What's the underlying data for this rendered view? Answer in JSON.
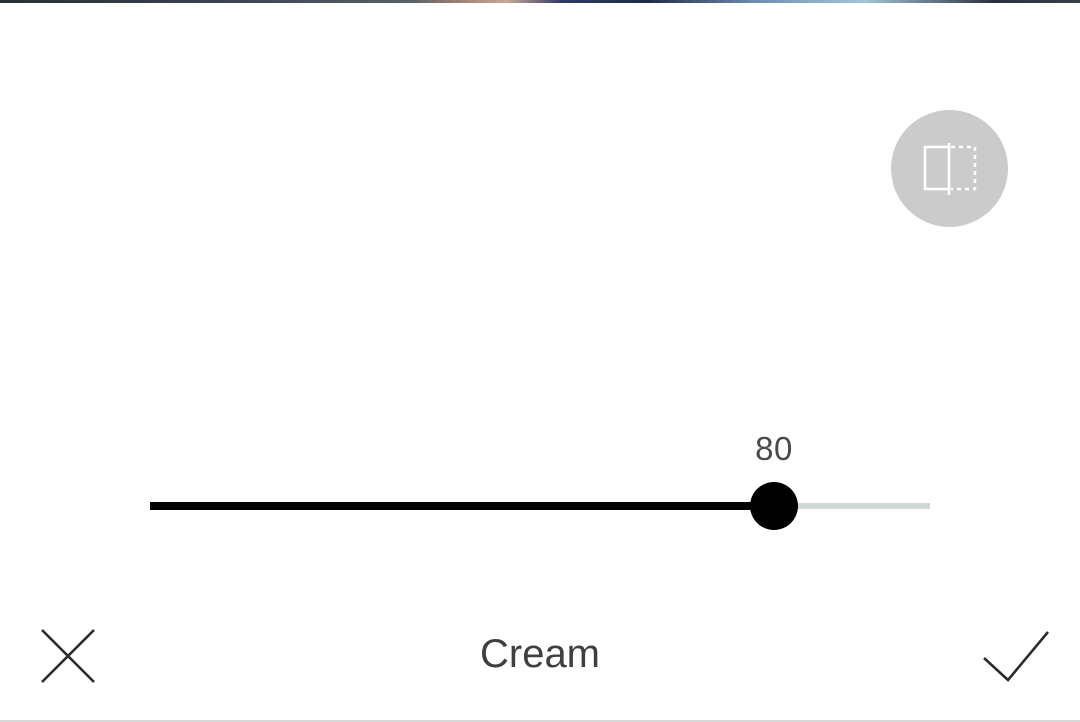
{
  "editor": {
    "filter_name": "Cream",
    "intensity": {
      "value": 80,
      "min": 0,
      "max": 100,
      "value_label": "80"
    }
  },
  "icons": {
    "compare": "compare-split-icon",
    "cancel": "close-icon",
    "confirm": "checkmark-icon"
  },
  "colors": {
    "background": "#ffffff",
    "slider_fill": "#000000",
    "slider_track": "#d1d6d6",
    "compare_button_bg": "#cbcbcb",
    "text": "#3f3f3f"
  }
}
